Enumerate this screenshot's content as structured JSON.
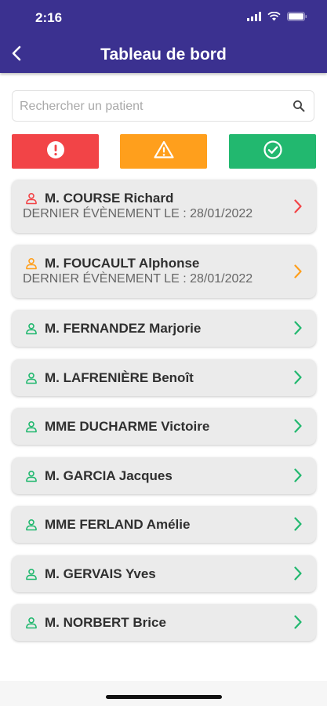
{
  "status_bar": {
    "time": "2:16"
  },
  "header": {
    "title": "Tableau de bord"
  },
  "search": {
    "placeholder": "Rechercher un patient"
  },
  "colors": {
    "header": "#3b3190",
    "alert": "#f24447",
    "warning": "#ff9f1c",
    "ok": "#22b86f"
  },
  "filters": [
    {
      "icon": "exclamation-icon",
      "color": "#f24447"
    },
    {
      "icon": "warning-triangle-icon",
      "color": "#ff9f1c"
    },
    {
      "icon": "check-circle-icon",
      "color": "#22b86f"
    }
  ],
  "patients": [
    {
      "name": "M. COURSE Richard",
      "last_event": "DERNIER ÉVÈNEMENT LE : 28/01/2022",
      "status": "alert"
    },
    {
      "name": "M. FOUCAULT Alphonse",
      "last_event": "DERNIER ÉVÈNEMENT LE : 28/01/2022",
      "status": "warning"
    },
    {
      "name": "M. FERNANDEZ Marjorie",
      "status": "ok"
    },
    {
      "name": "M. LAFRENIÈRE Benoît",
      "status": "ok"
    },
    {
      "name": "MME DUCHARME Victoire",
      "status": "ok"
    },
    {
      "name": "M. GARCIA Jacques",
      "status": "ok"
    },
    {
      "name": "MME FERLAND Amélie",
      "status": "ok"
    },
    {
      "name": "M. GERVAIS Yves",
      "status": "ok"
    },
    {
      "name": "M. NORBERT Brice",
      "status": "ok"
    }
  ]
}
